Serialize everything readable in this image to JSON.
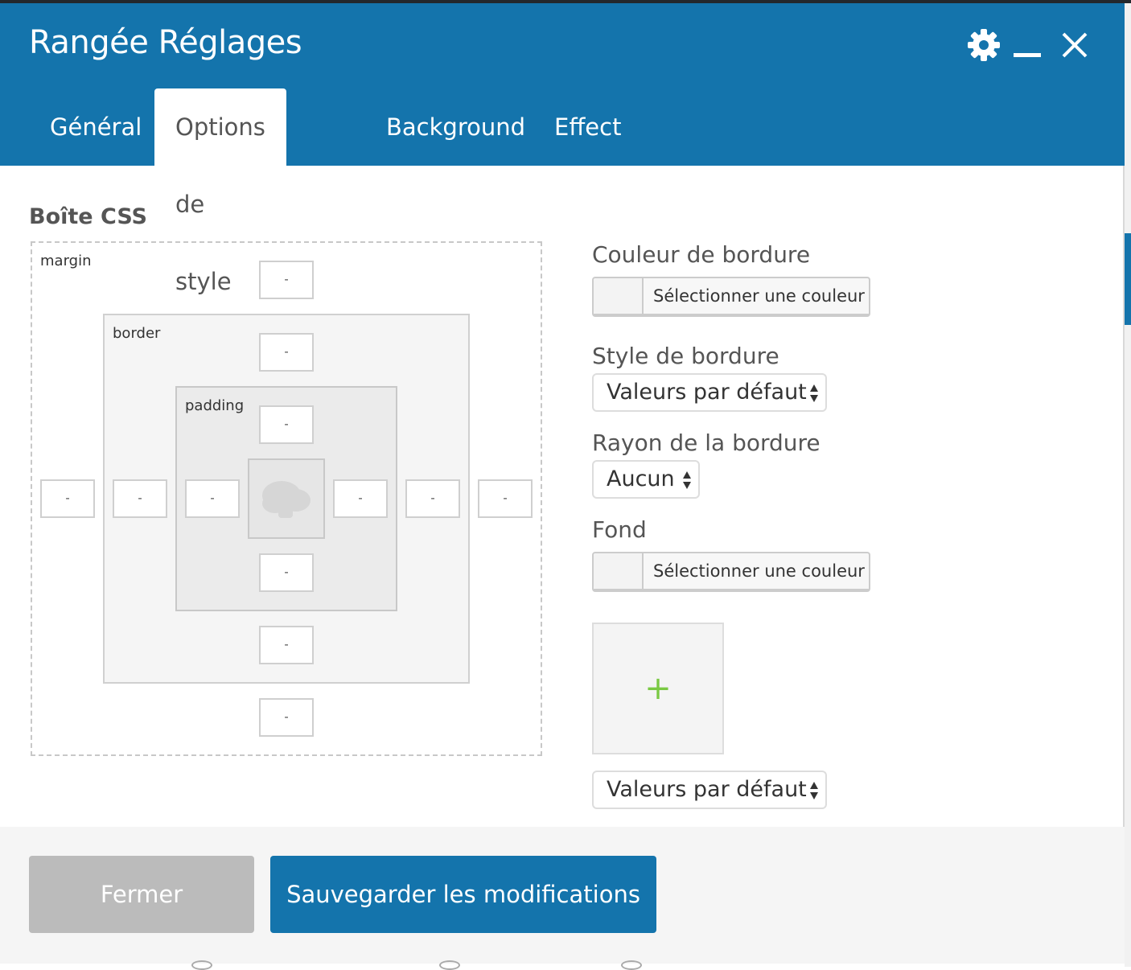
{
  "window": {
    "title": "Rangée Réglages",
    "icons": [
      "gear-icon",
      "minimize-icon",
      "close-icon"
    ]
  },
  "tabs": [
    {
      "label": "Général",
      "active": false
    },
    {
      "label": "Options de style",
      "active": true
    },
    {
      "label": "Background",
      "active": false
    },
    {
      "label": "Effect",
      "active": false
    }
  ],
  "css_box": {
    "label": "Boîte CSS",
    "margin_label": "margin",
    "border_label": "border",
    "padding_label": "padding",
    "margin": {
      "top": "-",
      "right": "-",
      "bottom": "-",
      "left": "-"
    },
    "border": {
      "top": "-",
      "right": "-",
      "bottom": "-",
      "left": "-"
    },
    "padding": {
      "top": "-",
      "right": "-",
      "bottom": "-",
      "left": "-"
    },
    "content_icon": "cloud-placeholder-icon"
  },
  "fields": {
    "border_color": {
      "label": "Couleur de bordure",
      "button": "Sélectionner une couleur"
    },
    "border_style": {
      "label": "Style de bordure",
      "value": "Valeurs par défaut"
    },
    "border_radius": {
      "label": "Rayon de la bordure",
      "value": "Aucun"
    },
    "background": {
      "label": "Fond",
      "button": "Sélectionner une couleur"
    },
    "background_image": {
      "icon": "plus-icon",
      "symbol": "+"
    },
    "background_style": {
      "value": "Valeurs par défaut"
    }
  },
  "footer": {
    "close_label": "Fermer",
    "save_label": "Sauvegarder les modifications"
  },
  "colors": {
    "header": "#1474ac",
    "primary_button": "#1474ac",
    "close_button": "#bbbbbb",
    "plus": "#7ac943"
  }
}
